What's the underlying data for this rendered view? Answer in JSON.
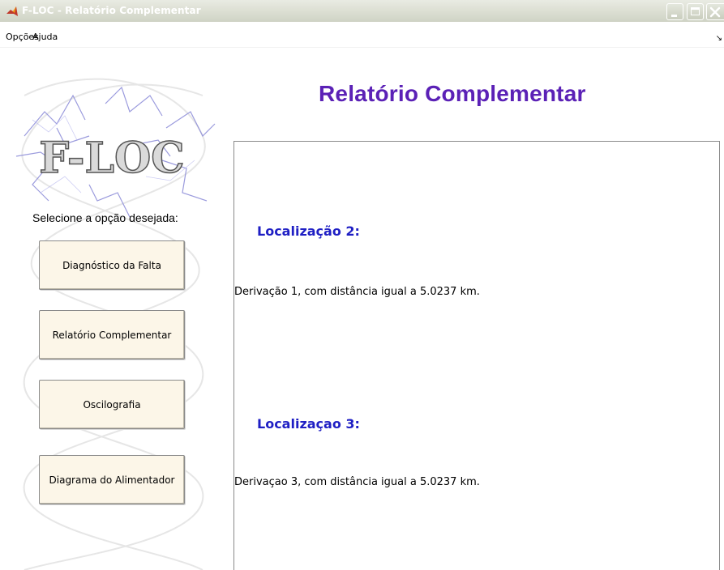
{
  "window": {
    "title": "F-LOC - Relatório Complementar"
  },
  "menu": {
    "items": [
      "Opções",
      "Ajuda"
    ]
  },
  "logo": {
    "text": "F-LOC"
  },
  "sidebar": {
    "prompt": "Selecione a opção desejada:",
    "buttons": [
      "Diagnóstico da Falta",
      "Relatório Complementar",
      "Oscilografia",
      "Diagrama do Alimentador"
    ]
  },
  "main": {
    "title": "Relatório Complementar",
    "sections": [
      {
        "heading": "Localização 2:",
        "text": "Derivação 1, com distância igual a 5.0237 km."
      },
      {
        "heading": "Localizaçao 3:",
        "text": "Derivaçao 3, com distância igual a 5.0237 km."
      }
    ]
  },
  "colors": {
    "title": "#5b21b6",
    "heading": "#1f1fc4",
    "button_bg": "#fcf6e8"
  }
}
